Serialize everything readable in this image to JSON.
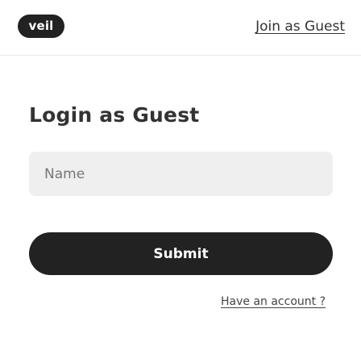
{
  "header": {
    "logo_text": "veil",
    "join_link": "Join as Guest"
  },
  "form": {
    "title": "Login as Guest",
    "name_placeholder": "Name",
    "name_value": "",
    "submit_label": "Submit",
    "account_link": "Have an account ?"
  },
  "colors": {
    "primary": "#222222",
    "input_background": "#efefef",
    "background": "#ffffff"
  }
}
